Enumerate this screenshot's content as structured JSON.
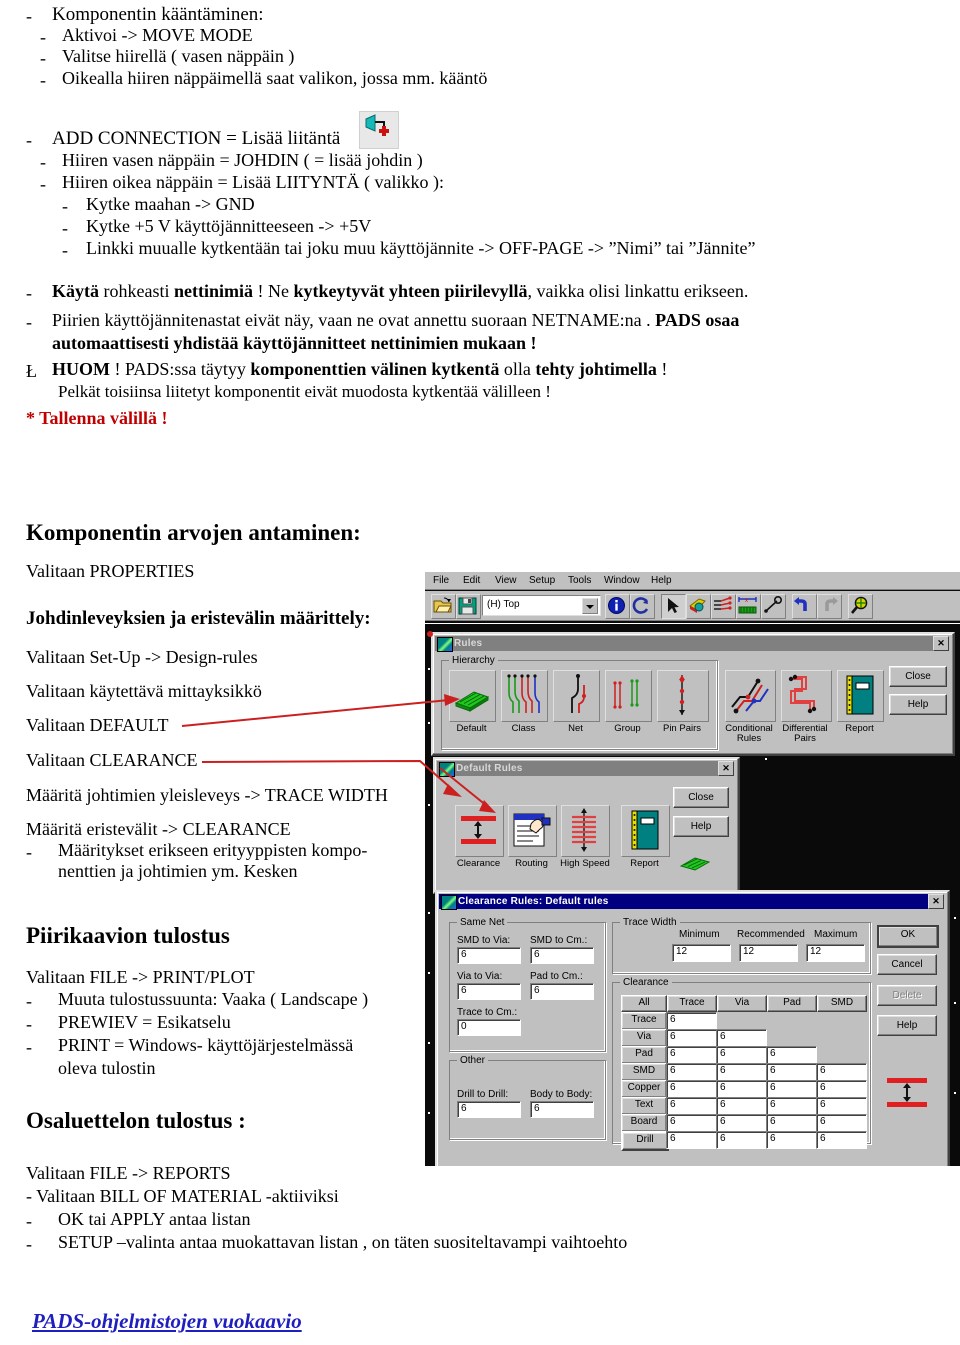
{
  "colors": {
    "red_accent": "#c00000",
    "link_blue": "#1f1fc0",
    "arrow_red": "#cc2020",
    "win_face": "#c0c0c0",
    "title_active": "#000080",
    "title_inactive": "#808080"
  },
  "notes": {
    "bullet_dash": "-",
    "l_marker": "Ł",
    "line1": "Komponentin kääntäminen:",
    "line2": "Aktivoi -> MOVE MODE",
    "line3": "Valitse hiirellä ( vasen näppäin )",
    "line4": "Oikealla hiiren näppäimellä saat valikon, jossa mm. kääntö",
    "line5": "ADD CONNECTION  = Lisää liitäntä",
    "line6": "Hiiren vasen näppäin = JOHDIN ( = lisää johdin )",
    "line7": "Hiiren oikea näppäin = Lisää LIITYNTÄ  ( valikko ):",
    "line8": "Kytke maahan -> GND",
    "line9": "Kytke +5 V käyttöjännitteeseen -> +5V",
    "line10": "Linkki muualle kytkentään tai joku muu käyttöjännite -> OFF-PAGE -> ”Nimi” tai ”Jännite”",
    "line11_a": "Käytä",
    "line11_b": " rohkeasti ",
    "line11_c": "nettinimiä",
    "line11_d": " !  Ne ",
    "line11_e": "kytkeytyvät yhteen piirilevyllä",
    "line11_f": ", vaikka olisi linkattu erikseen.",
    "line12_a": "Piirien käyttöjännitenastat eivät näy, vaan ne ovat annettu suoraan NETNAME:na . ",
    "line12_b": "PADS osaa",
    "line13": "automaattisesti yhdistää käyttöjännitteet nettinimien mukaan !",
    "line14_a": "HUOM",
    "line14_b": " ! PADS:ssa täytyy ",
    "line14_c": "komponenttien välinen kytkentä",
    "line14_d": " olla ",
    "line14_e": "tehty johtimella",
    "line14_f": " !",
    "line15": "Pelkät toisiinsa liitetyt komponentit eivät muodosta kytkentää välilleen !",
    "line16": "* Tallenna välillä !"
  },
  "sections": {
    "heading1": "Komponentin arvojen antaminen:",
    "h1_line1": "Valitaan PROPERTIES",
    "heading2": "Johdinleveyksien ja eristevälin määrittely:",
    "h2_line1": "Valitaan Set-Up -> Design-rules",
    "h2_line2": "Valitaan käytettävä mittayksikkö",
    "h2_line3": "Valitaan DEFAULT",
    "h2_line4": "Valitaan CLEARANCE",
    "h2_line5": "Määritä johtimien yleisleveys -> TRACE WIDTH",
    "h2_line6": "Määritä eristevälit -> CLEARANCE",
    "h2_line7": "Määritykset erikseen erityyppisten kompo-",
    "h2_line8": "nenttien ja johtimien ym. Kesken",
    "heading3": "Piirikaavion tulostus",
    "h3_line1": "Valitaan FILE -> PRINT/PLOT",
    "h3_line2": "Muuta tulostussuunta: Vaaka ( Landscape )",
    "h3_line3": "PREWIEV = Esikatselu",
    "h3_line4": "PRINT = Windows- käyttöjärjestelmässä",
    "h3_line5": "oleva tulostin",
    "heading4": "Osaluettelon tulostus :",
    "h4_line1": "Valitaan FILE -> REPORTS",
    "h4_line2": "- Valitaan BILL OF MATERIAL -aktiiviksi",
    "h4_line3": "OK tai APPLY antaa listan",
    "h4_line4": "SETUP –valinta antaa muokattavan listan , on täten suositeltavampi vaihtoehto",
    "footer_link": "PADS-ohjelmistojen vuokaavio"
  },
  "screenshot": {
    "menu": [
      {
        "label": "File",
        "accel": "F"
      },
      {
        "label": "Edit",
        "accel": "E"
      },
      {
        "label": "View",
        "accel": "V"
      },
      {
        "label": "Setup",
        "accel": "S"
      },
      {
        "label": "Tools",
        "accel": "T"
      },
      {
        "label": "Window",
        "accel": "W"
      },
      {
        "label": "Help",
        "accel": "H"
      }
    ],
    "toolbar": {
      "open_icon": "open-folder-icon",
      "save_icon": "floppy-disk-icon",
      "layer_combo_value": "(H) Top",
      "info_icon": "info-icon",
      "refresh_icon": "refresh-icon",
      "select_icon": "arrow-select-icon",
      "board_icon": "board-outline-icon",
      "nets_icon": "nets-icon",
      "dimension_icon": "dimension-icon",
      "pin_icon": "pin-tool-icon",
      "undo_icon": "undo-icon",
      "redo_icon": "redo-icon",
      "zoom_icon": "zoom-icon"
    },
    "rules_dialog": {
      "title": "Rules",
      "group_label": "Hierarchy",
      "hierarchy_buttons": [
        {
          "label": "Default",
          "icon": "pcb-board-icon"
        },
        {
          "label": "Class",
          "icon": "net-class-icon"
        },
        {
          "label": "Net",
          "icon": "single-net-icon"
        },
        {
          "label": "Group",
          "icon": "group-nets-icon"
        },
        {
          "label": "Pin Pairs",
          "icon": "pin-pairs-icon"
        }
      ],
      "extra_buttons": [
        {
          "label": "Conditional",
          "label2": "Rules",
          "icon": "conditional-rules-icon"
        },
        {
          "label": "Differential",
          "label2": "Pairs",
          "icon": "differential-pairs-icon"
        },
        {
          "label": "Report",
          "label2": "",
          "icon": "report-book-icon"
        }
      ],
      "close_label": "Close",
      "help_label": "Help",
      "close_accel": "C",
      "help_accel": "H"
    },
    "default_rules_dialog": {
      "title": "Default Rules",
      "buttons": [
        {
          "label": "Clearance",
          "icon": "clearance-icon"
        },
        {
          "label": "Routing",
          "icon": "routing-hand-icon"
        },
        {
          "label": "High Speed",
          "icon": "high-speed-icon"
        },
        {
          "label": "Report",
          "icon": "report-book-icon"
        }
      ],
      "close_label": "Close",
      "help_label": "Help"
    },
    "clearance_dialog": {
      "title": "Clearance Rules: Default rules",
      "same_net": {
        "group_label": "Same Net",
        "fields": [
          {
            "label": "SMD to Via:",
            "value": "6"
          },
          {
            "label": "SMD to Cm.:",
            "value": "6"
          },
          {
            "label": "Via to Via:",
            "value": "6"
          },
          {
            "label": "Pad to Cm.:",
            "value": "6"
          },
          {
            "label": "Trace to Cm.:",
            "value": "0"
          }
        ]
      },
      "other": {
        "group_label": "Other",
        "fields": [
          {
            "label": "Drill to Drill:",
            "value": "6"
          },
          {
            "label": "Body to Body:",
            "value": "6"
          }
        ]
      },
      "trace_width": {
        "group_label": "Trace Width",
        "headers": [
          "Minimum",
          "Recommended",
          "Maximum"
        ],
        "values": [
          "12",
          "12",
          "12"
        ]
      },
      "clearance": {
        "group_label": "Clearance",
        "columns": [
          "All",
          "Trace",
          "Via",
          "Pad",
          "SMD"
        ],
        "rows": [
          {
            "label": "Trace",
            "values": [
              "6"
            ]
          },
          {
            "label": "Via",
            "values": [
              "6",
              "6"
            ]
          },
          {
            "label": "Pad",
            "values": [
              "6",
              "6",
              "6"
            ]
          },
          {
            "label": "SMD",
            "values": [
              "6",
              "6",
              "6",
              "6"
            ]
          },
          {
            "label": "Copper",
            "values": [
              "6",
              "6",
              "6",
              "6"
            ]
          },
          {
            "label": "Text",
            "values": [
              "6",
              "6",
              "6",
              "6"
            ]
          },
          {
            "label": "Board",
            "values": [
              "6",
              "6",
              "6",
              "6"
            ]
          },
          {
            "label": "Drill",
            "values": [
              "6",
              "6",
              "6",
              "6"
            ]
          }
        ]
      },
      "buttons": [
        {
          "label": "OK",
          "state": "default"
        },
        {
          "label": "Cancel",
          "state": "normal"
        },
        {
          "label": "Delete",
          "state": "disabled"
        },
        {
          "label": "Help",
          "state": "normal"
        }
      ]
    }
  }
}
